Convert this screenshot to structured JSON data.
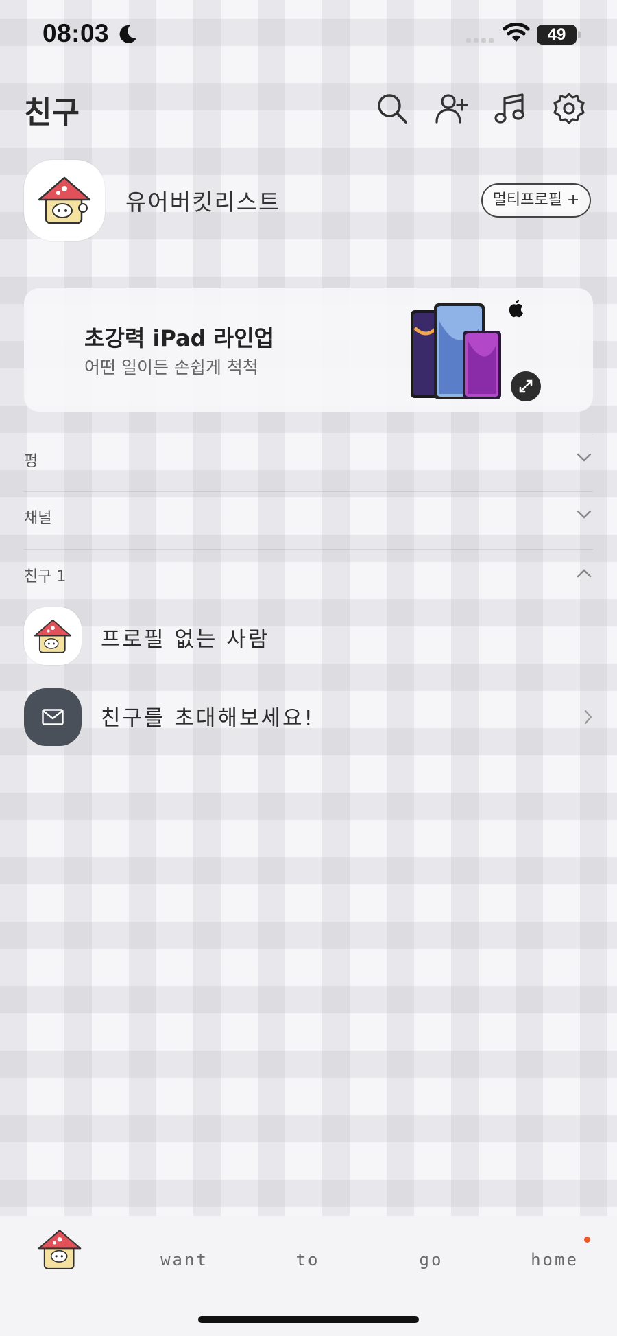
{
  "status_bar": {
    "time": "08:03",
    "battery": "49"
  },
  "header": {
    "title": "친구",
    "icons": [
      "search-icon",
      "add-friend-icon",
      "music-icon",
      "settings-icon"
    ]
  },
  "my_profile": {
    "name": "유어버킷리스트",
    "multi_profile_label": "멀티프로필 +"
  },
  "ad": {
    "title": "초강력 iPad 라인업",
    "subtitle": "어떤 일이든 손쉽게 척척"
  },
  "sections": {
    "pung": "펑",
    "channel": "채널",
    "friends": "친구 1"
  },
  "friends": [
    {
      "name": "프로필 없는 사람"
    }
  ],
  "invite": {
    "label": "친구를 초대해보세요!"
  },
  "tab_bar": {
    "tabs": [
      "want",
      "to",
      "go",
      "home"
    ]
  },
  "colors": {
    "badge_dot": "#f0582a",
    "invite_icon_bg": "#4a5059"
  }
}
